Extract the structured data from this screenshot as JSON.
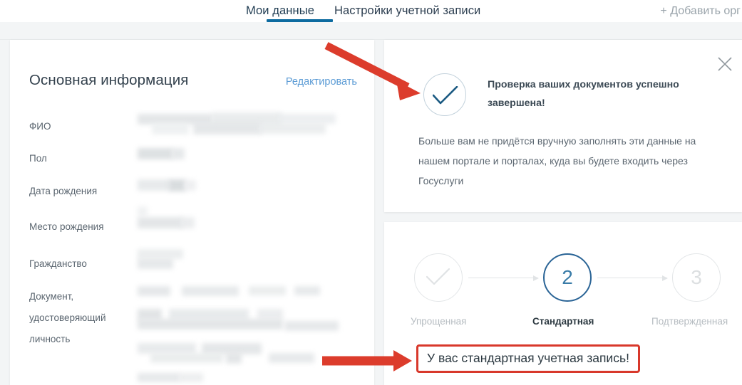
{
  "tabs": [
    {
      "label": "Мои данные",
      "active": true
    },
    {
      "label": "Настройки учетной записи",
      "active": false
    }
  ],
  "header": {
    "add_org_label": "+ Добавить орг"
  },
  "left_panel": {
    "title": "Основная информация",
    "edit_link": "Редактировать",
    "fields": [
      {
        "label": "ФИО"
      },
      {
        "label": "Пол"
      },
      {
        "label": "Дата рождения"
      },
      {
        "label": "Место рождения"
      },
      {
        "label": "Гражданство"
      },
      {
        "label": "Документ, удостоверяющий личность"
      }
    ],
    "field_lines": {
      "document_label_line1": "Документ,",
      "document_label_line2": "удостоверяющий",
      "document_label_line3": "личность"
    }
  },
  "success_card": {
    "icon": "check-circle-icon",
    "title": "Проверка ваших документов успешно завершена!",
    "body": "Больше вам не придётся вручную заполнять эти данные на нашем портале и порталах, куда вы будете входить через Госуслуги",
    "close_icon": "close-icon"
  },
  "account_level": {
    "steps": [
      {
        "marker": "✓",
        "label": "Упрощенная",
        "state": "done"
      },
      {
        "marker": "2",
        "label": "Стандартная",
        "state": "current"
      },
      {
        "marker": "3",
        "label": "Подтвержденная",
        "state": "pending"
      }
    ],
    "status_text": "У вас стандартная учетная запись!"
  },
  "colors": {
    "tab_accent": "#0d6ba0",
    "link": "#5b9bd5",
    "check_stroke": "#1b5a82",
    "current_step": "#2a6496",
    "annotation_red": "#dc3c2c",
    "highlight_border": "#d8382b"
  },
  "annotations": [
    {
      "name": "arrow-to-success-card",
      "color": "#dc3c2c"
    },
    {
      "name": "arrow-to-status-pill",
      "color": "#dc3c2c"
    }
  ]
}
